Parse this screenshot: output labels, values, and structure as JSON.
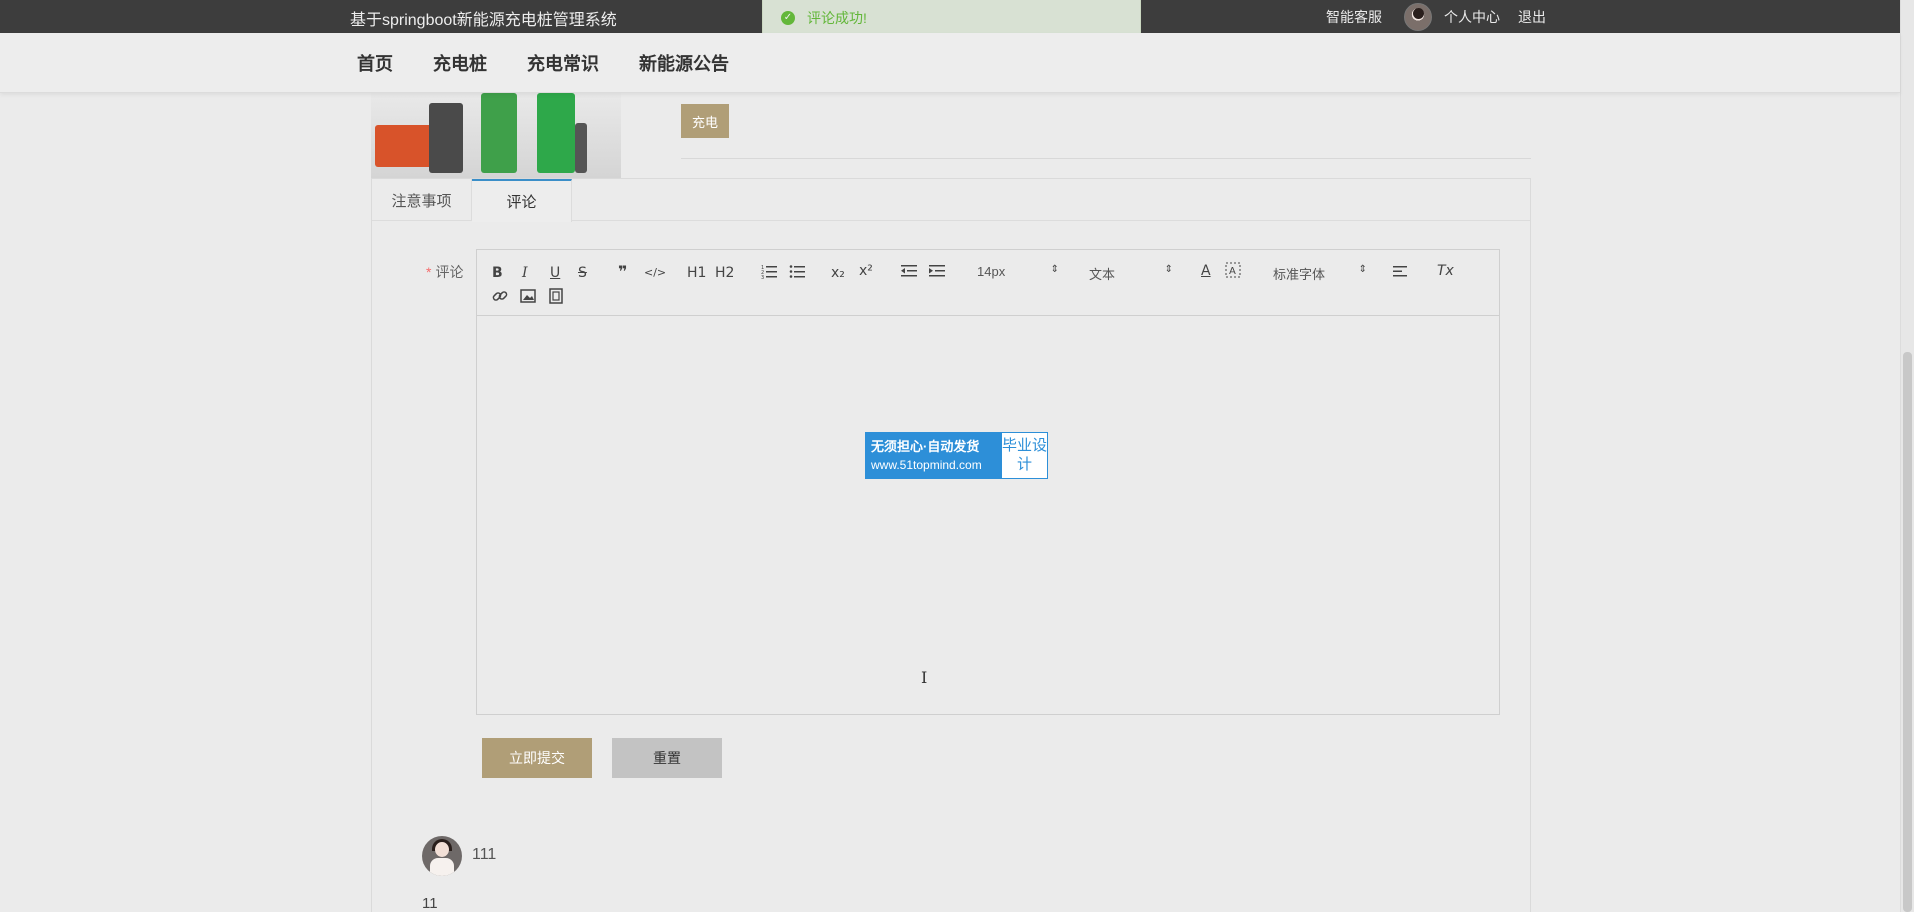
{
  "header": {
    "system_title": "基于springboot新能源充电桩管理系统",
    "customer_service": "智能客服",
    "personal_center": "个人中心",
    "logout": "退出"
  },
  "toast": {
    "message": "评论成功!",
    "status_color": "#67c23a"
  },
  "nav": {
    "items": [
      "首页",
      "充电桩",
      "充电常识",
      "新能源公告"
    ]
  },
  "product": {
    "tag_button": "充电"
  },
  "tabs": [
    {
      "label": "注意事项",
      "active": false
    },
    {
      "label": "评论",
      "active": true
    }
  ],
  "form": {
    "required_mark": "*",
    "comment_label": "评论",
    "submit_label": "立即提交",
    "reset_label": "重置"
  },
  "editor": {
    "font_size": "14px",
    "block_format": "文本",
    "font_family": "标准字体",
    "toolbar": {
      "bold": "B",
      "italic": "I",
      "underline": "U",
      "strike": "S",
      "blockquote": "❞",
      "code": "</>",
      "h1": "H1",
      "h2": "H2",
      "subscript": "x₂",
      "superscript": "x²",
      "text_color": "A",
      "clear_format": "Tx"
    },
    "watermark": {
      "line1": "无须担心·自动发货",
      "line2": "www.51topmind.com",
      "side": "毕业设计"
    }
  },
  "comments": [
    {
      "user": "111",
      "content": "11"
    }
  ],
  "colors": {
    "accent": "#b09e77",
    "reset_button": "#c3c3c3",
    "active_tab_border": "#3a8ec8",
    "topbar": "#3d3d3d"
  }
}
